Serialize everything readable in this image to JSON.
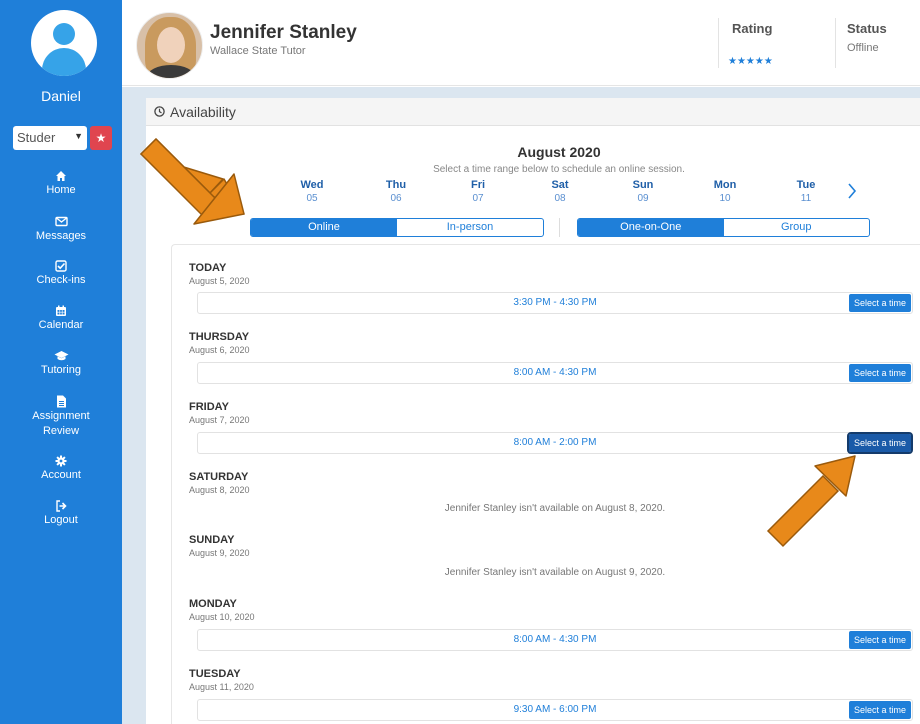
{
  "sidebar": {
    "user_name": "Daniel",
    "role_selected": "Studer",
    "nav": [
      {
        "label": "Home"
      },
      {
        "label": "Messages"
      },
      {
        "label": "Check-ins"
      },
      {
        "label": "Calendar"
      },
      {
        "label": "Tutoring"
      },
      {
        "label": "Assignment Review"
      },
      {
        "label": "Account"
      },
      {
        "label": "Logout"
      }
    ]
  },
  "header": {
    "tutor_name": "Jennifer Stanley",
    "tutor_subtitle": "Wallace State Tutor",
    "rating_label": "Rating",
    "rating_stars": "★★★★★",
    "rating_value": 5,
    "status_label": "Status",
    "status_value": "Offline"
  },
  "availability": {
    "title": "Availability",
    "month": "August 2020",
    "hint": "Select a time range below to schedule an online session.",
    "days": [
      {
        "name": "Wed",
        "date": "05"
      },
      {
        "name": "Thu",
        "date": "06"
      },
      {
        "name": "Fri",
        "date": "07"
      },
      {
        "name": "Sat",
        "date": "08"
      },
      {
        "name": "Sun",
        "date": "09"
      },
      {
        "name": "Mon",
        "date": "10"
      },
      {
        "name": "Tue",
        "date": "11"
      }
    ],
    "mode_options": [
      "Online",
      "In-person"
    ],
    "mode_selected": "Online",
    "type_options": [
      "One-on-One",
      "Group"
    ],
    "type_selected": "One-on-One",
    "select_label": "Select a time",
    "schedule": [
      {
        "day": "TODAY",
        "date": "August 5, 2020",
        "slot": "3:30 PM - 4:30 PM"
      },
      {
        "day": "THURSDAY",
        "date": "August 6, 2020",
        "slot": "8:00 AM - 4:30 PM"
      },
      {
        "day": "FRIDAY",
        "date": "August 7, 2020",
        "slot": "8:00 AM - 2:00 PM"
      },
      {
        "day": "SATURDAY",
        "date": "August 8, 2020",
        "unavailable": "Jennifer Stanley isn't available on August 8, 2020."
      },
      {
        "day": "SUNDAY",
        "date": "August 9, 2020",
        "unavailable": "Jennifer Stanley isn't available on August 9, 2020."
      },
      {
        "day": "MONDAY",
        "date": "August 10, 2020",
        "slot": "8:00 AM - 4:30 PM"
      },
      {
        "day": "TUESDAY",
        "date": "August 11, 2020",
        "slot": "9:30 AM - 6:00 PM"
      }
    ]
  },
  "colors": {
    "primary": "#1f7fd9",
    "danger": "#e0454f",
    "arrow": "#e8891a"
  }
}
